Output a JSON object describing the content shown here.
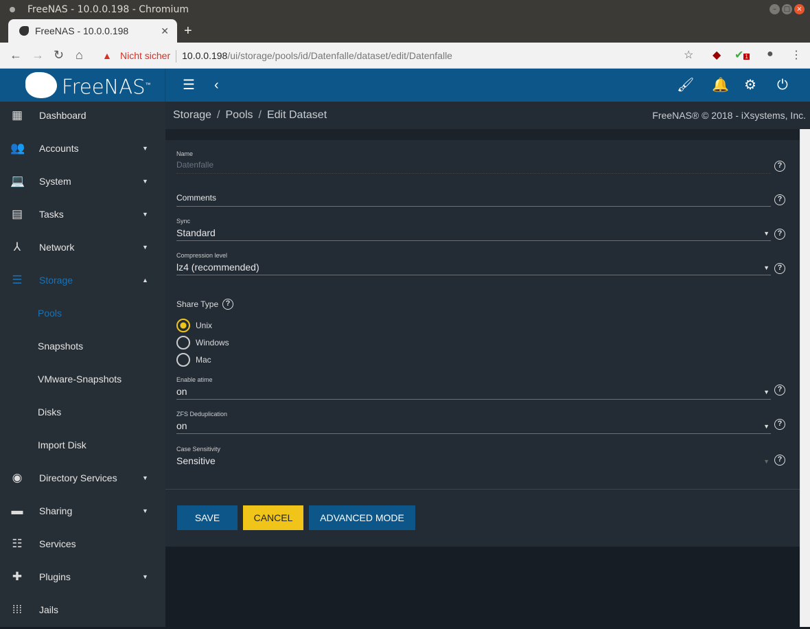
{
  "browser": {
    "window_title": "FreeNAS - 10.0.0.198 - Chromium",
    "tab_title": "FreeNAS - 10.0.0.198",
    "security": "Nicht sicher",
    "url_host": "10.0.0.198",
    "url_path": "/ui/storage/pools/id/Datenfalle/dataset/edit/Datenfalle",
    "ext_badge": "1"
  },
  "app": {
    "logo": "FreeNAS",
    "copyright": "FreeNAS® © 2018 - iXsystems, Inc."
  },
  "breadcrumb": [
    "Storage",
    "Pools",
    "Edit Dataset"
  ],
  "sidebar": [
    {
      "label": "Dashboard",
      "icon": "dashboard-icon"
    },
    {
      "label": "Accounts",
      "icon": "people-icon",
      "caret": true
    },
    {
      "label": "System",
      "icon": "laptop-icon",
      "caret": true
    },
    {
      "label": "Tasks",
      "icon": "calendar-icon",
      "caret": true
    },
    {
      "label": "Network",
      "icon": "network-icon",
      "caret": true
    },
    {
      "label": "Storage",
      "icon": "storage-icon",
      "caret": true
    },
    {
      "label": "Pools"
    },
    {
      "label": "Snapshots"
    },
    {
      "label": "VMware-Snapshots"
    },
    {
      "label": "Disks"
    },
    {
      "label": "Import Disk"
    },
    {
      "label": "Directory Services",
      "icon": "directory-icon",
      "caret": true
    },
    {
      "label": "Sharing",
      "icon": "sharing-icon",
      "caret": true
    },
    {
      "label": "Services",
      "icon": "tune-icon"
    },
    {
      "label": "Plugins",
      "icon": "puzzle-icon",
      "caret": true
    },
    {
      "label": "Jails",
      "icon": "grid-icon"
    }
  ],
  "form": {
    "name": {
      "label": "Name",
      "value": "Datenfalle"
    },
    "comments": {
      "placeholder": "Comments"
    },
    "sync": {
      "label": "Sync",
      "value": "Standard"
    },
    "compression": {
      "label": "Compression level",
      "value": "lz4 (recommended)"
    },
    "share_type": {
      "label": "Share Type",
      "options": [
        "Unix",
        "Windows",
        "Mac"
      ],
      "selected": "Unix"
    },
    "atime": {
      "label": "Enable atime",
      "value": "on"
    },
    "dedup": {
      "label": "ZFS Deduplication",
      "value": "on"
    },
    "case": {
      "label": "Case Sensitivity",
      "value": "Sensitive"
    }
  },
  "buttons": {
    "save": "SAVE",
    "cancel": "CANCEL",
    "advanced": "ADVANCED MODE"
  },
  "colors": {
    "primary": "#0d5689",
    "accent": "#f0c419"
  }
}
